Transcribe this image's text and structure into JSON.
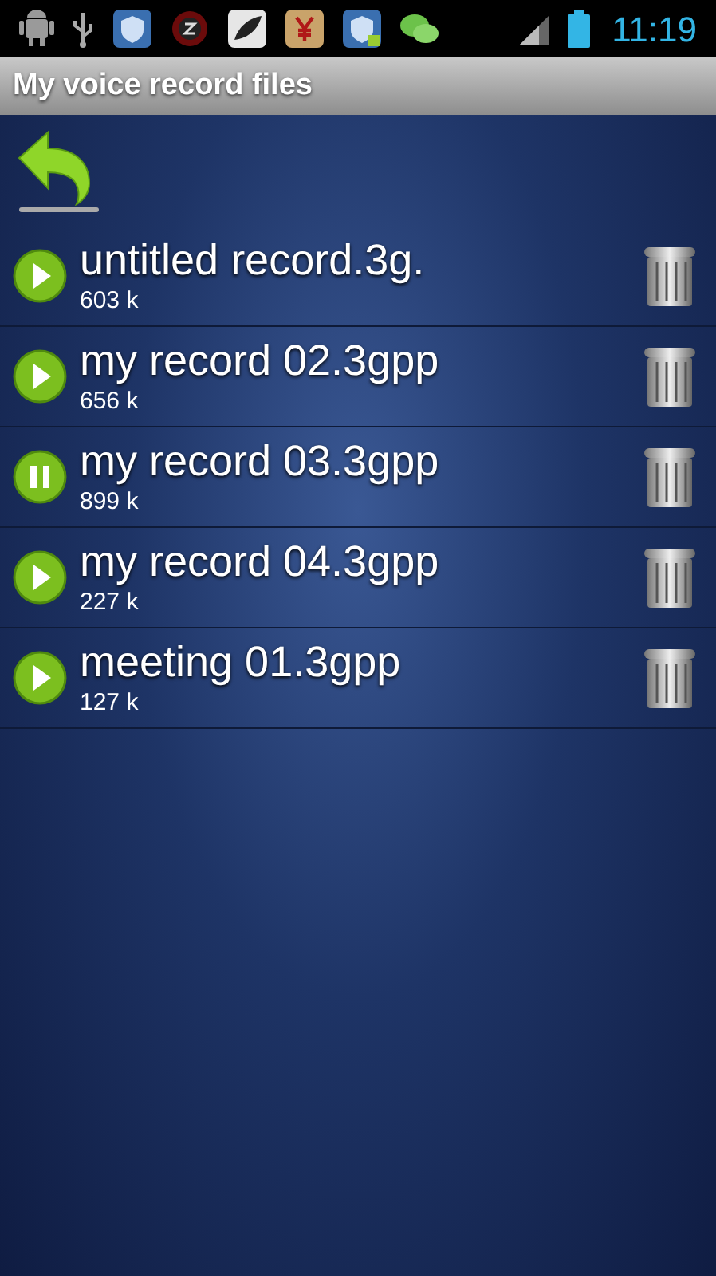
{
  "status_bar": {
    "time": "11:19"
  },
  "window": {
    "title": "My voice record files"
  },
  "records": [
    {
      "name": "untitled record.3g.",
      "size": "603 k",
      "playing": false
    },
    {
      "name": "my record 02.3gpp",
      "size": "656 k",
      "playing": false
    },
    {
      "name": "my record 03.3gpp",
      "size": "899 k",
      "playing": true
    },
    {
      "name": "my record 04.3gpp",
      "size": "227 k",
      "playing": false
    },
    {
      "name": "meeting 01.3gpp",
      "size": "127 k",
      "playing": false
    }
  ]
}
